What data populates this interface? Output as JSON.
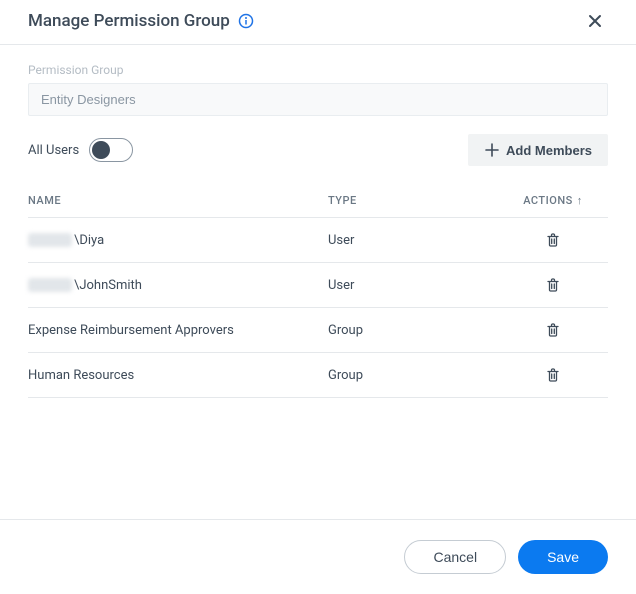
{
  "header": {
    "title": "Manage Permission Group"
  },
  "form": {
    "permission_group_label": "Permission Group",
    "permission_group_value": "Entity Designers",
    "all_users_label": "All Users",
    "add_members_label": "Add Members"
  },
  "table": {
    "columns": {
      "name": "NAME",
      "type": "TYPE",
      "actions": "ACTIONS"
    },
    "rows": [
      {
        "name_suffix": "\\Diya",
        "has_prefix_blur": true,
        "type": "User"
      },
      {
        "name_suffix": "\\JohnSmith",
        "has_prefix_blur": true,
        "type": "User"
      },
      {
        "name_suffix": "Expense Reimbursement Approvers",
        "has_prefix_blur": false,
        "type": "Group"
      },
      {
        "name_suffix": "Human Resources",
        "has_prefix_blur": false,
        "type": "Group"
      }
    ]
  },
  "footer": {
    "cancel": "Cancel",
    "save": "Save"
  }
}
